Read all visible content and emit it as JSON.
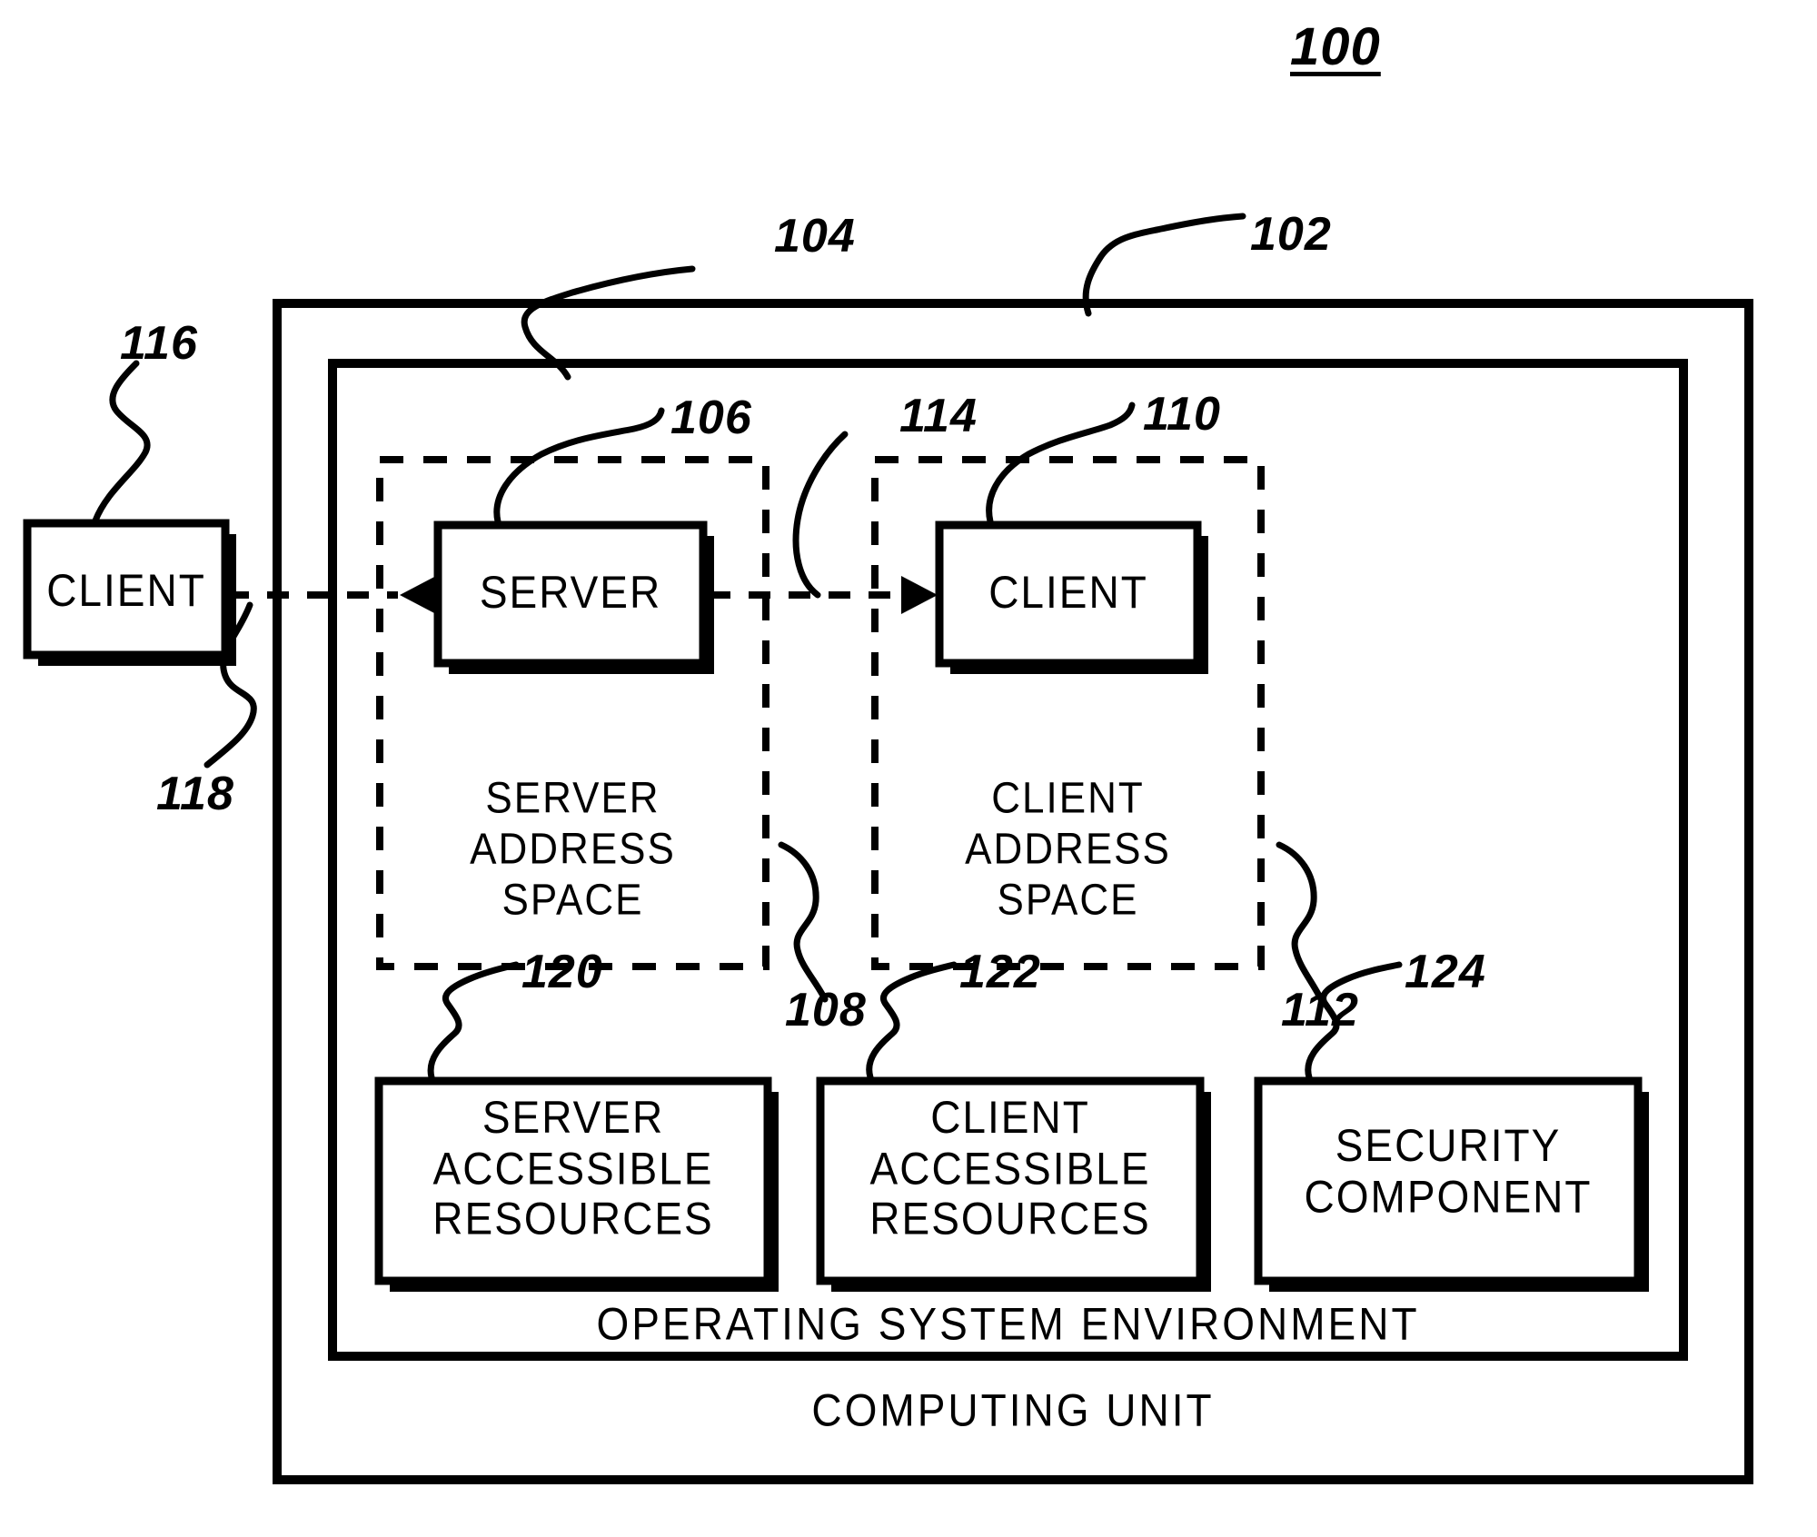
{
  "figure": {
    "number": "100",
    "title": "Client-server computing unit architecture diagram"
  },
  "refs": {
    "r100": "100",
    "r102": "102",
    "r104": "104",
    "r106": "106",
    "r108": "108",
    "r110": "110",
    "r112": "112",
    "r114": "114",
    "r116": "116",
    "r118": "118",
    "r120": "120",
    "r122": "122",
    "r124": "124"
  },
  "boxes": {
    "external_client": "CLIENT",
    "server": "SERVER",
    "internal_client": "CLIENT",
    "server_accessible_resources": "SERVER\nACCESSIBLE\nRESOURCES",
    "client_accessible_resources": "CLIENT\nACCESSIBLE\nRESOURCES",
    "security_component": "SECURITY\nCOMPONENT"
  },
  "regions": {
    "server_address_space": "SERVER\nADDRESS\nSPACE",
    "client_address_space": "CLIENT\nADDRESS\nSPACE",
    "operating_system_environment": "OPERATING SYSTEM ENVIRONMENT",
    "computing_unit": "COMPUTING UNIT"
  },
  "colors": {
    "stroke": "#000000",
    "background": "#ffffff"
  }
}
